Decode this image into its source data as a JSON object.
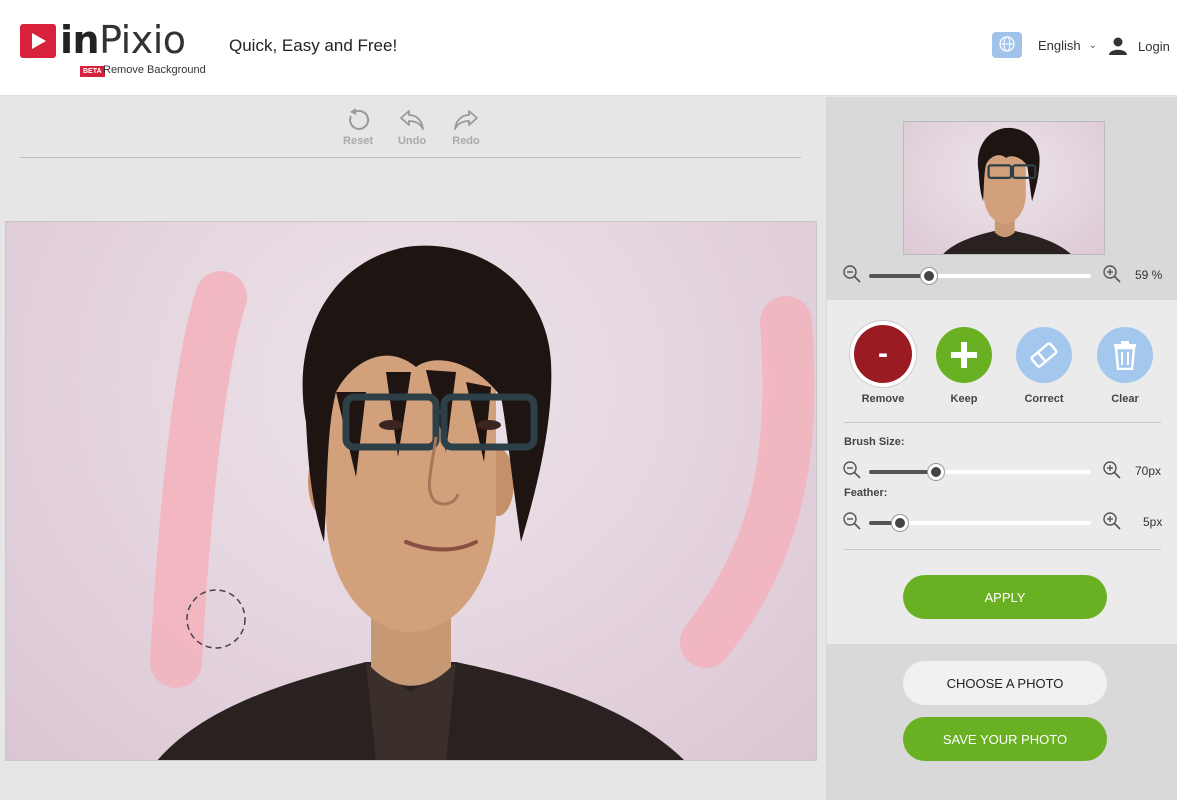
{
  "header": {
    "logo_in": "in",
    "logo_pixio": "Pixio",
    "logo_beta": "BETA",
    "logo_sub": "Remove Background",
    "tagline": "Quick, Easy and Free!",
    "language": "English",
    "login": "Login"
  },
  "toolbar": {
    "reset": "Reset",
    "undo": "Undo",
    "redo": "Redo"
  },
  "navigator": {
    "zoom_value": "59 %",
    "zoom_level": 0.27
  },
  "tools": {
    "remove": "Remove",
    "remove_glyph": "-",
    "keep": "Keep",
    "correct": "Correct",
    "clear": "Clear"
  },
  "brush": {
    "size_label": "Brush Size:",
    "size_value": "70px",
    "size_level": 0.3,
    "feather_label": "Feather:",
    "feather_value": "5px",
    "feather_level": 0.14
  },
  "actions": {
    "apply": "APPLY",
    "choose": "CHOOSE A PHOTO",
    "save": "SAVE YOUR PHOTO"
  },
  "colors": {
    "remove": "#9b1b22",
    "keep": "#6ab023",
    "correct": "#a4c7ee",
    "clear": "#a4c7ee",
    "brand_red": "#d8213a",
    "stroke_pink": "#f3b4be"
  }
}
